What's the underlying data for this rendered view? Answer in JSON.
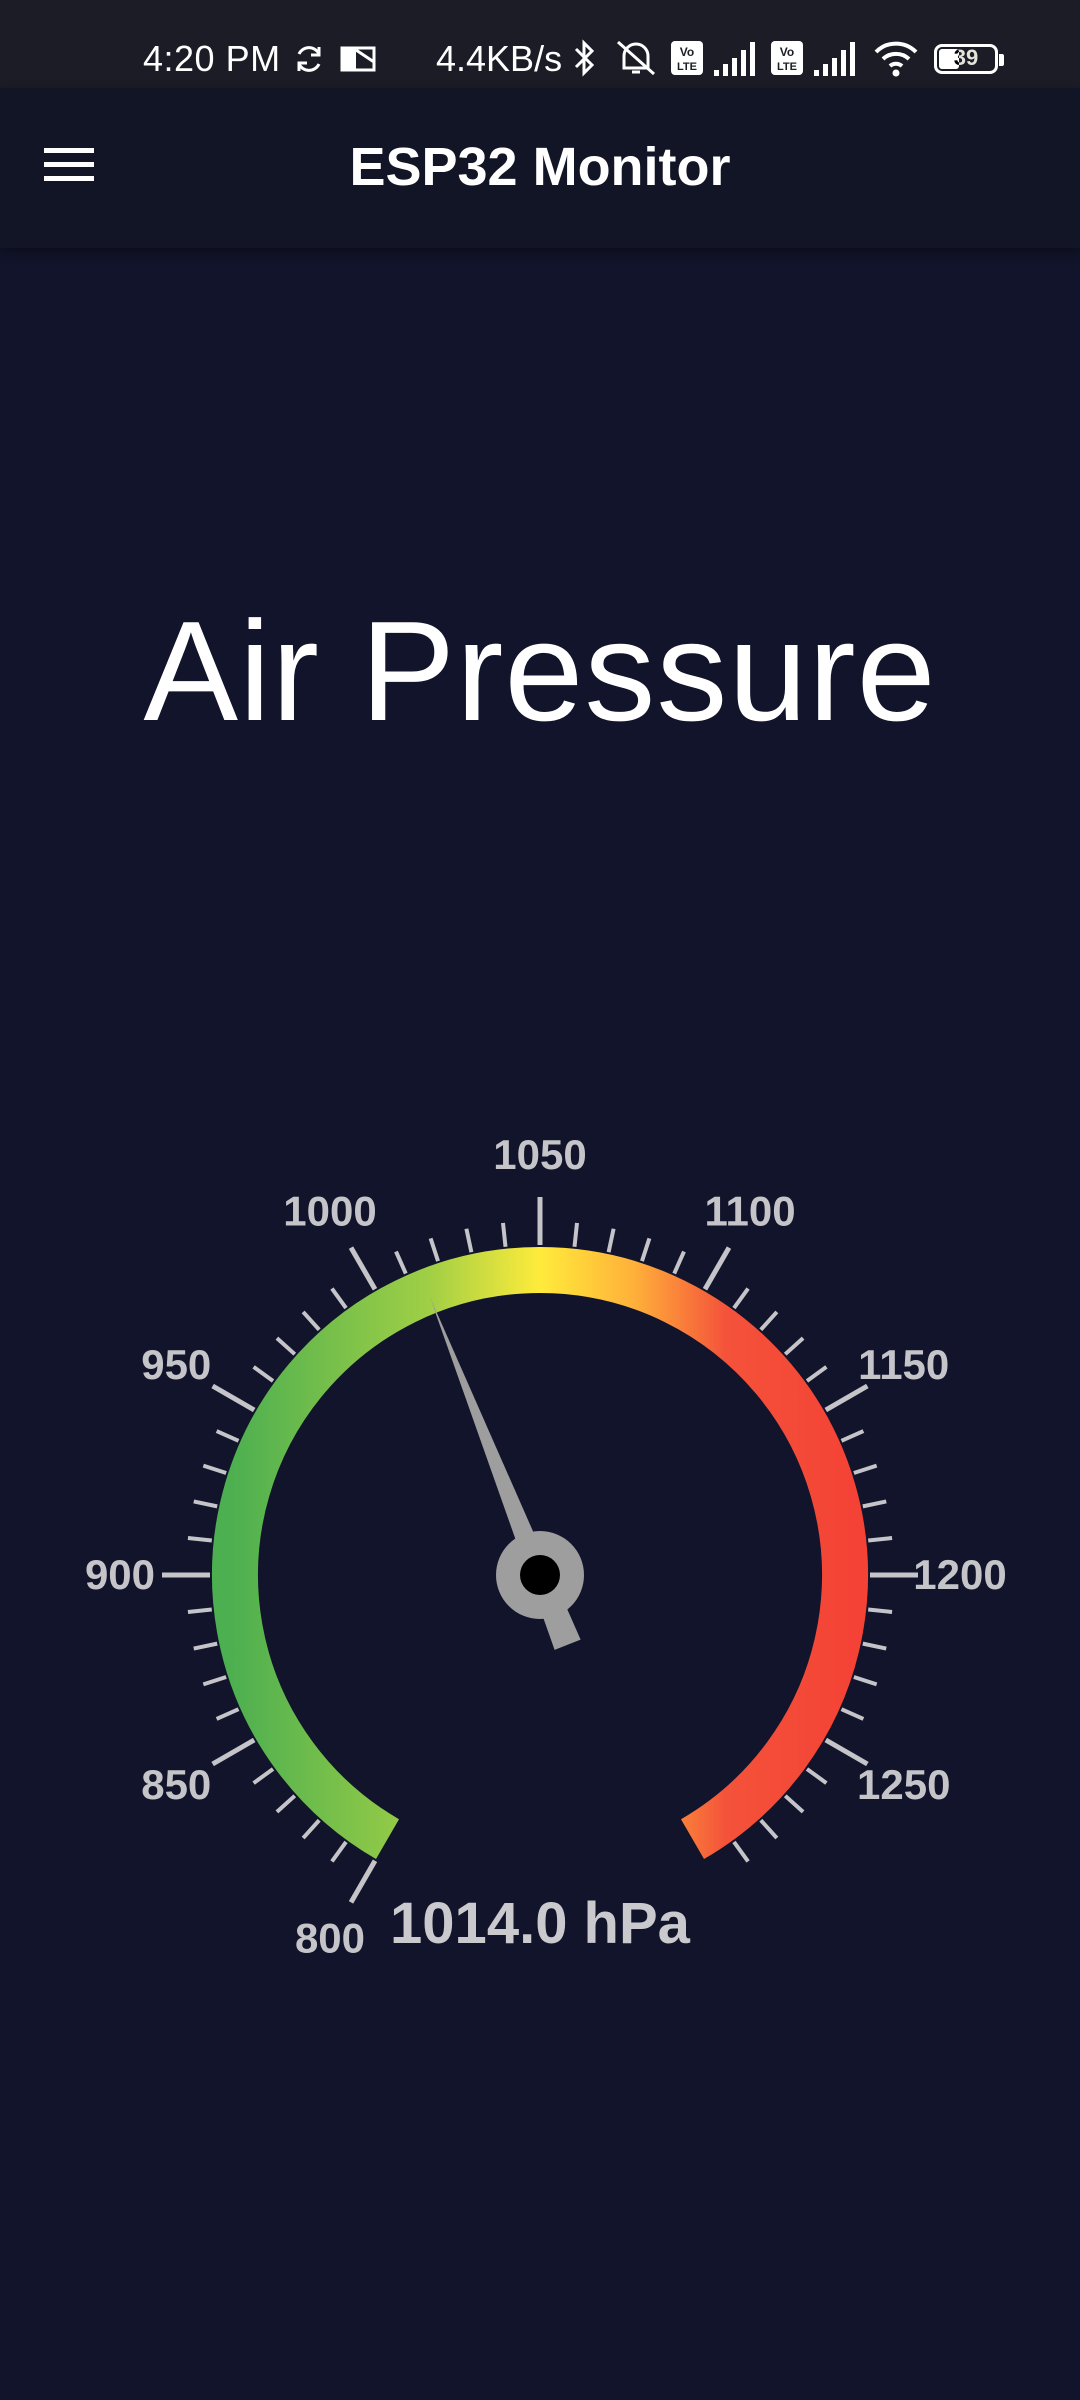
{
  "status_bar": {
    "time": "4:20 PM",
    "network_speed": "4.4KB/s",
    "battery": "39",
    "icons": [
      "sync-icon",
      "mail-icon",
      "bluetooth-icon",
      "mute-icon",
      "volte-icon",
      "signal-icon",
      "volte-icon",
      "signal-icon",
      "wifi-icon",
      "battery-icon"
    ]
  },
  "app_bar": {
    "title": "ESP32 Monitor",
    "menu_icon": "hamburger-menu-icon"
  },
  "main": {
    "heading": "Air Pressure"
  },
  "gauge": {
    "value": 1014.0,
    "value_text": "1014.0 hPa",
    "unit": "hPa",
    "min": 800,
    "max": 1300,
    "major_ticks": [
      "800",
      "850",
      "900",
      "950",
      "1000",
      "1050",
      "1100",
      "1150",
      "1200",
      "1250"
    ],
    "colors": {
      "green": "#4caf50",
      "yellow": "#ffeb3b",
      "orange": "#ff9800",
      "red": "#f44336",
      "needle": "#9e9e9e",
      "tick": "#c4c4c9"
    }
  }
}
